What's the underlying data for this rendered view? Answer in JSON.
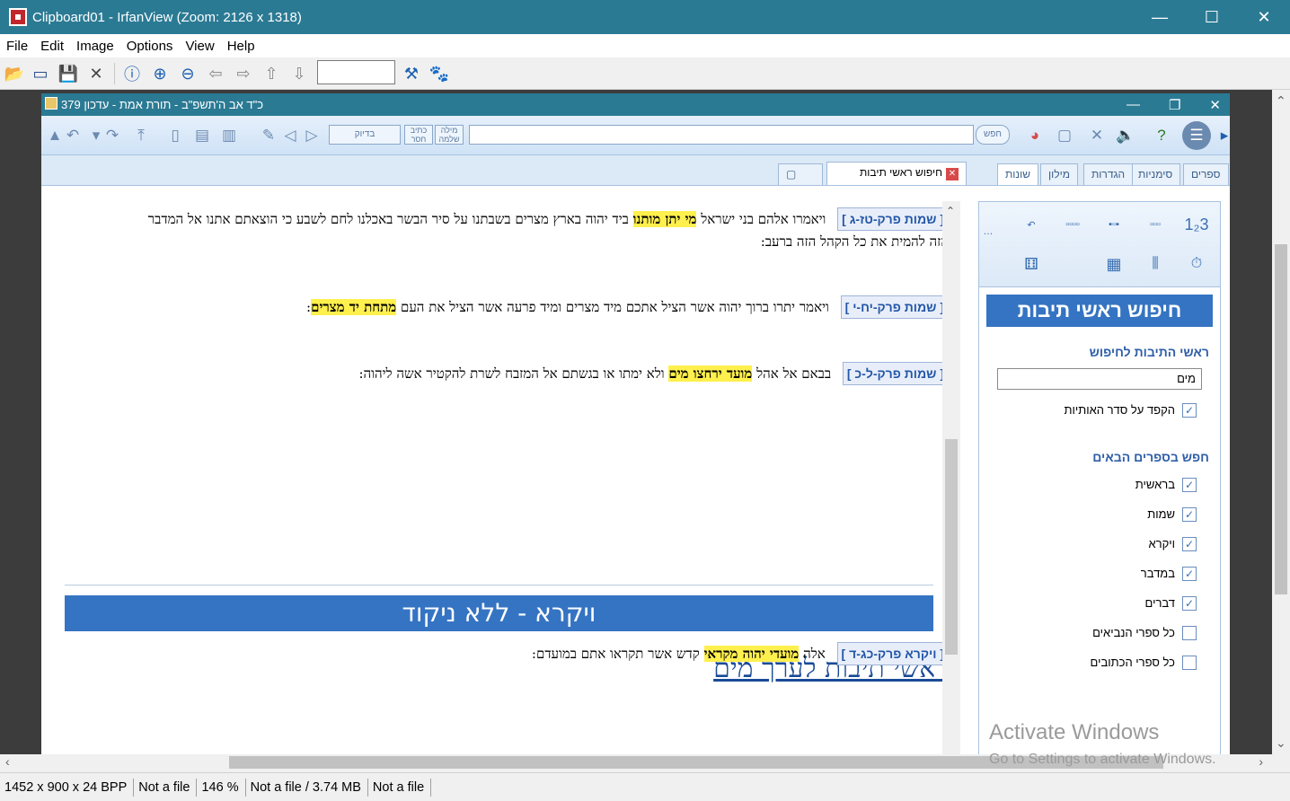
{
  "window": {
    "title": "Clipboard01 - IrfanView (Zoom: 2126 x 1318)",
    "minimize": "—",
    "maximize": "☐",
    "close": "✕"
  },
  "menu": [
    "File",
    "Edit",
    "Image",
    "Options",
    "View",
    "Help"
  ],
  "toolbar": {
    "page_input": ""
  },
  "inner_app": {
    "title": "כ\"ד אב ה'תשפ\"ב  -  תורת אמת - עדכון 379",
    "toolbar": {
      "search_button": "חפש",
      "search_value": "",
      "btn_ketiv": "כתיב חסר",
      "btn_mila": "מילה שלמה",
      "btn_exact": "בדיוק"
    },
    "tabs": {
      "active": "חיפוש ראשי תיבות",
      "right_tabs": [
        "ספרים",
        "סימניות",
        "הגדרות",
        "מילון",
        "שונות"
      ]
    }
  },
  "document": {
    "verses": [
      {
        "ref": "[ שמות פרק-טז-ג ]",
        "before": "ויאמרו אלהם בני ישראל",
        "highlight": "מי יתן מותנו",
        "after": "ביד יהוה בארץ מצרים בשבתנו על סיר הבשר באכלנו לחם לשבע כי הוצאתם אתנו אל המדבר הזה להמית את כל הקהל הזה ברעב:"
      },
      {
        "ref": "[ שמות פרק-יח-י ]",
        "before": "ויאמר יתרו ברוך יהוה אשר הציל אתכם מיד מצרים ומיד פרעה אשר הציל את העם",
        "highlight": "מתחת יד מצרים",
        "after": ":"
      },
      {
        "ref": "[ שמות פרק-ל-כ ]",
        "before": "בבאם אל אהל",
        "highlight": "מועד ירחצו מים",
        "after": "ולא ימתו או בגשתם אל המזבח לשרת להקטיר אשה ליהוה:"
      },
      {
        "ref": "[ ויקרא פרק-כג-ד ]",
        "before": "אלה",
        "highlight": "מועדי יהוה מקראי",
        "after": "קדש אשר תקראו אתם במועדם:"
      }
    ],
    "book_banner": "ויקרא - ללא ניקוד",
    "search_heading": "ראשי תיבות לערך מים"
  },
  "panel": {
    "title": "חיפוש ראשי תיבות",
    "input_label": "ראשי התיבות לחיפוש",
    "input_value": "מים",
    "strict_order": "הקפד על סדר האותיות",
    "books_label": "חפש בספרים הבאים",
    "books": [
      {
        "label": "בראשית",
        "checked": true
      },
      {
        "label": "שמות",
        "checked": true
      },
      {
        "label": "ויקרא",
        "checked": true
      },
      {
        "label": "במדבר",
        "checked": true
      },
      {
        "label": "דברים",
        "checked": true
      },
      {
        "label": "כל ספרי הנביאים",
        "checked": false
      },
      {
        "label": "כל ספרי הכתובים",
        "checked": false
      }
    ]
  },
  "watermark": {
    "line1": "Activate Windows",
    "line2": "Go to Settings to activate Windows."
  },
  "status": [
    "1452 x 900 x 24 BPP",
    "Not a file",
    "146 %",
    "Not a file / 3.74 MB",
    "Not a file"
  ]
}
